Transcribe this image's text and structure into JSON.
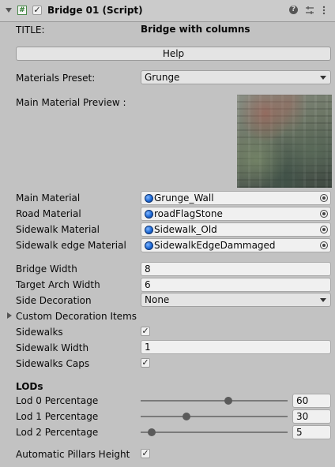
{
  "header": {
    "title": "Bridge 01 (Script)"
  },
  "title_row": {
    "label": "TITLE:",
    "value": "Bridge with columns"
  },
  "help_button": "Help",
  "materials_preset": {
    "label": "Materials Preset:",
    "value": "Grunge"
  },
  "preview": {
    "label": "Main Material Preview :"
  },
  "materials": [
    {
      "label": "Main Material",
      "value": "Grunge_Wall"
    },
    {
      "label": "Road Material",
      "value": "roadFlagStone"
    },
    {
      "label": "Sidewalk Material",
      "value": "Sidewalk_Old"
    },
    {
      "label": "Sidewalk edge Material",
      "value": "SidewalkEdgeDammaged"
    }
  ],
  "bridge_width": {
    "label": "Bridge Width",
    "value": "8"
  },
  "target_arch_width": {
    "label": "Target Arch Width",
    "value": "6"
  },
  "side_decoration": {
    "label": "Side Decoration",
    "value": "None"
  },
  "custom_decoration": {
    "label": "Custom Decoration Items"
  },
  "sidewalks": {
    "label": "Sidewalks",
    "checked": true
  },
  "sidewalk_width": {
    "label": "Sidewalk Width",
    "value": "1"
  },
  "sidewalks_caps": {
    "label": "Sidewalks Caps",
    "checked": true
  },
  "lods": {
    "heading": "LODs",
    "items": [
      {
        "label": "Lod 0 Percentage",
        "value": "60",
        "fraction": 0.6
      },
      {
        "label": "Lod 1 Percentage",
        "value": "30",
        "fraction": 0.3
      },
      {
        "label": "Lod 2 Percentage",
        "value": "5",
        "fraction": 0.05
      }
    ]
  },
  "auto_pillars": {
    "label": "Automatic Pillars Height",
    "checked": true
  },
  "check_glyph": "✓"
}
